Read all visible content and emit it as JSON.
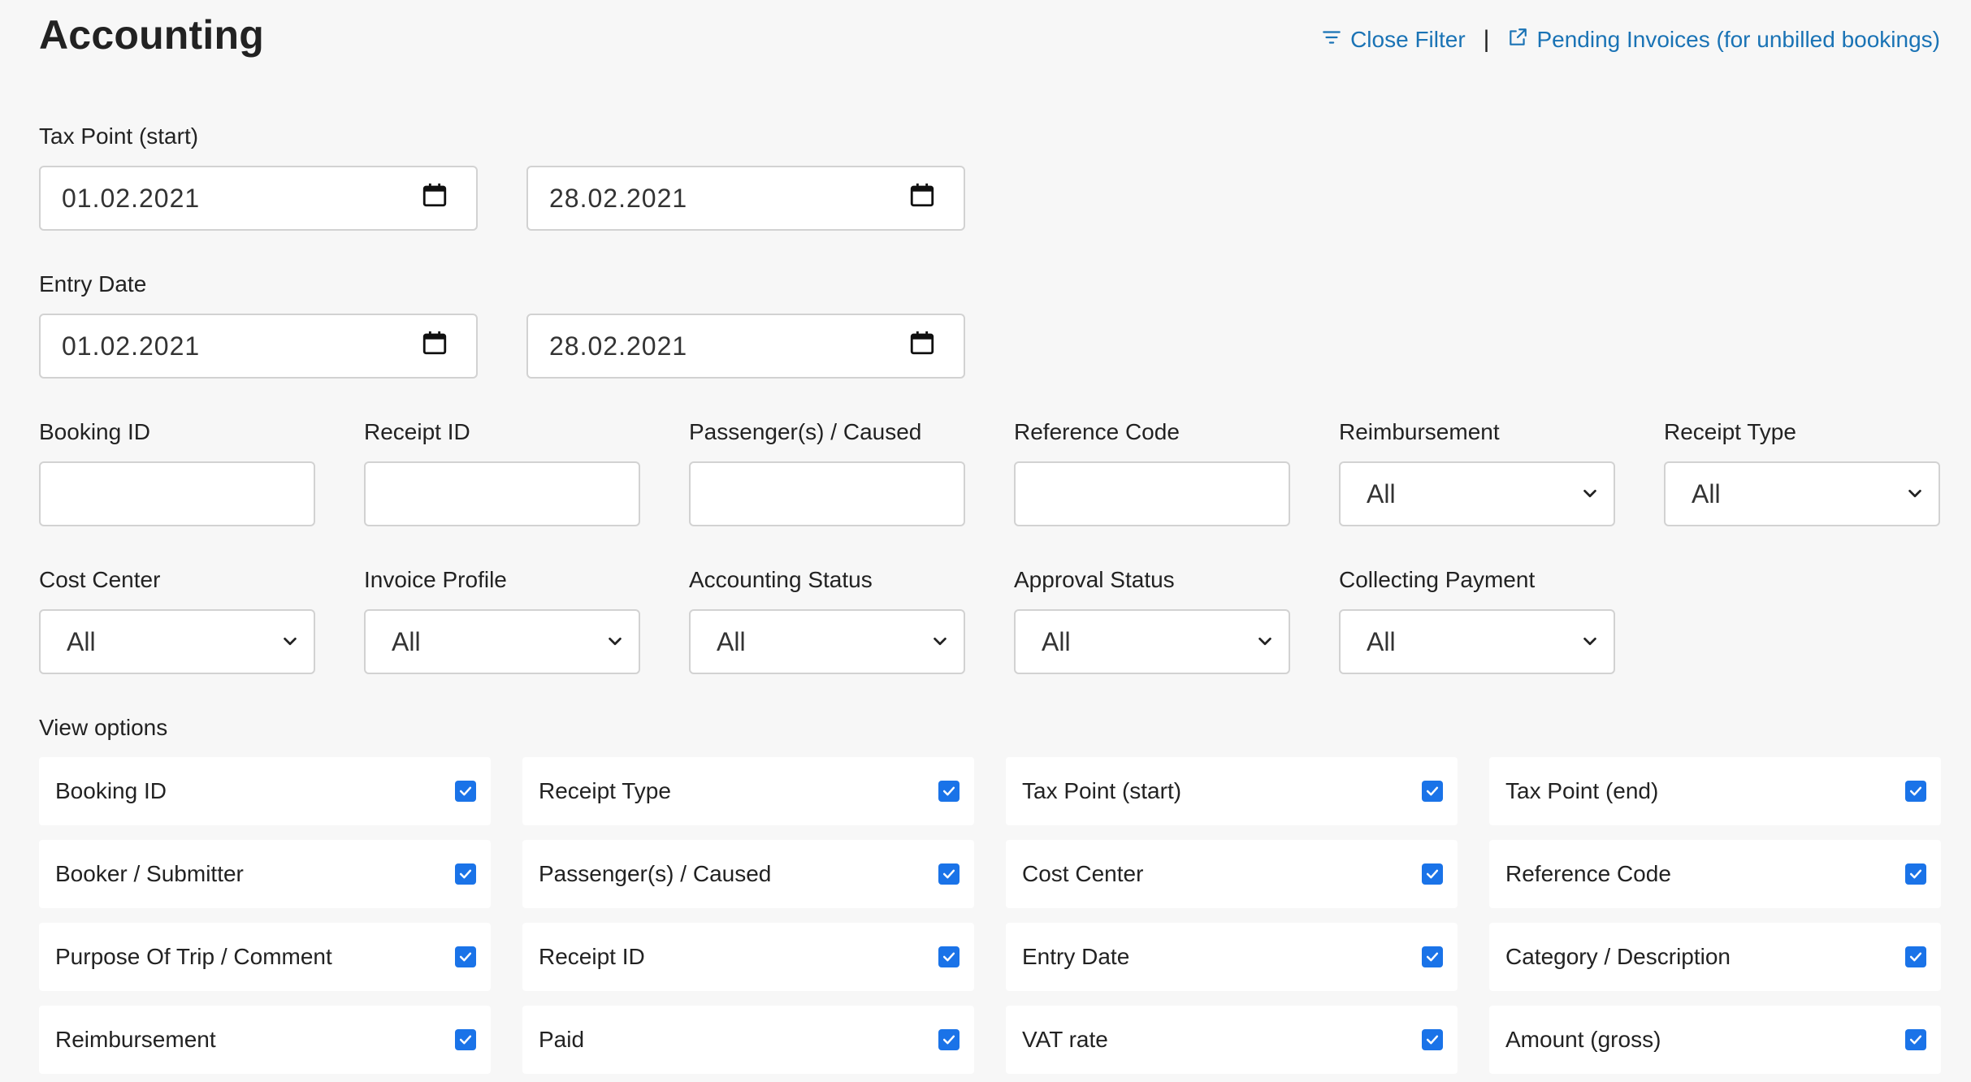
{
  "page": {
    "title": "Accounting"
  },
  "header_links": {
    "close_filter": "Close Filter",
    "separator": "|",
    "pending_invoices": "Pending Invoices (for unbilled bookings)"
  },
  "tax_point": {
    "label": "Tax Point (start)",
    "from": "01.02.2021",
    "to": "28.02.2021"
  },
  "entry_date": {
    "label": "Entry Date",
    "from": "01.02.2021",
    "to": "28.02.2021"
  },
  "filters_row1": {
    "booking_id": {
      "label": "Booking ID",
      "value": ""
    },
    "receipt_id": {
      "label": "Receipt ID",
      "value": ""
    },
    "passengers": {
      "label": "Passenger(s) / Caused",
      "value": ""
    },
    "reference_code": {
      "label": "Reference Code",
      "value": ""
    },
    "reimbursement": {
      "label": "Reimbursement",
      "value": "All"
    },
    "receipt_type": {
      "label": "Receipt Type",
      "value": "All"
    }
  },
  "filters_row2": {
    "cost_center": {
      "label": "Cost Center",
      "value": "All"
    },
    "invoice_profile": {
      "label": "Invoice Profile",
      "value": "All"
    },
    "accounting_status": {
      "label": "Accounting Status",
      "value": "All"
    },
    "approval_status": {
      "label": "Approval Status",
      "value": "All"
    },
    "collecting_payment": {
      "label": "Collecting Payment",
      "value": "All"
    }
  },
  "view_options": {
    "label": "View options",
    "items": [
      {
        "label": "Booking ID",
        "checked": true
      },
      {
        "label": "Receipt Type",
        "checked": true
      },
      {
        "label": "Tax Point (start)",
        "checked": true
      },
      {
        "label": "Tax Point (end)",
        "checked": true
      },
      {
        "label": "Booker / Submitter",
        "checked": true
      },
      {
        "label": "Passenger(s) / Caused",
        "checked": true
      },
      {
        "label": "Cost Center",
        "checked": true
      },
      {
        "label": "Reference Code",
        "checked": true
      },
      {
        "label": "Purpose Of Trip / Comment",
        "checked": true
      },
      {
        "label": "Receipt ID",
        "checked": true
      },
      {
        "label": "Entry Date",
        "checked": true
      },
      {
        "label": "Category / Description",
        "checked": true
      },
      {
        "label": "Reimbursement",
        "checked": true
      },
      {
        "label": "Paid",
        "checked": true
      },
      {
        "label": "VAT rate",
        "checked": true
      },
      {
        "label": "Amount (gross)",
        "checked": true
      }
    ]
  },
  "colors": {
    "link": "#1a73b5",
    "checkbox": "#1a73e8",
    "background": "#f7f7f7"
  }
}
